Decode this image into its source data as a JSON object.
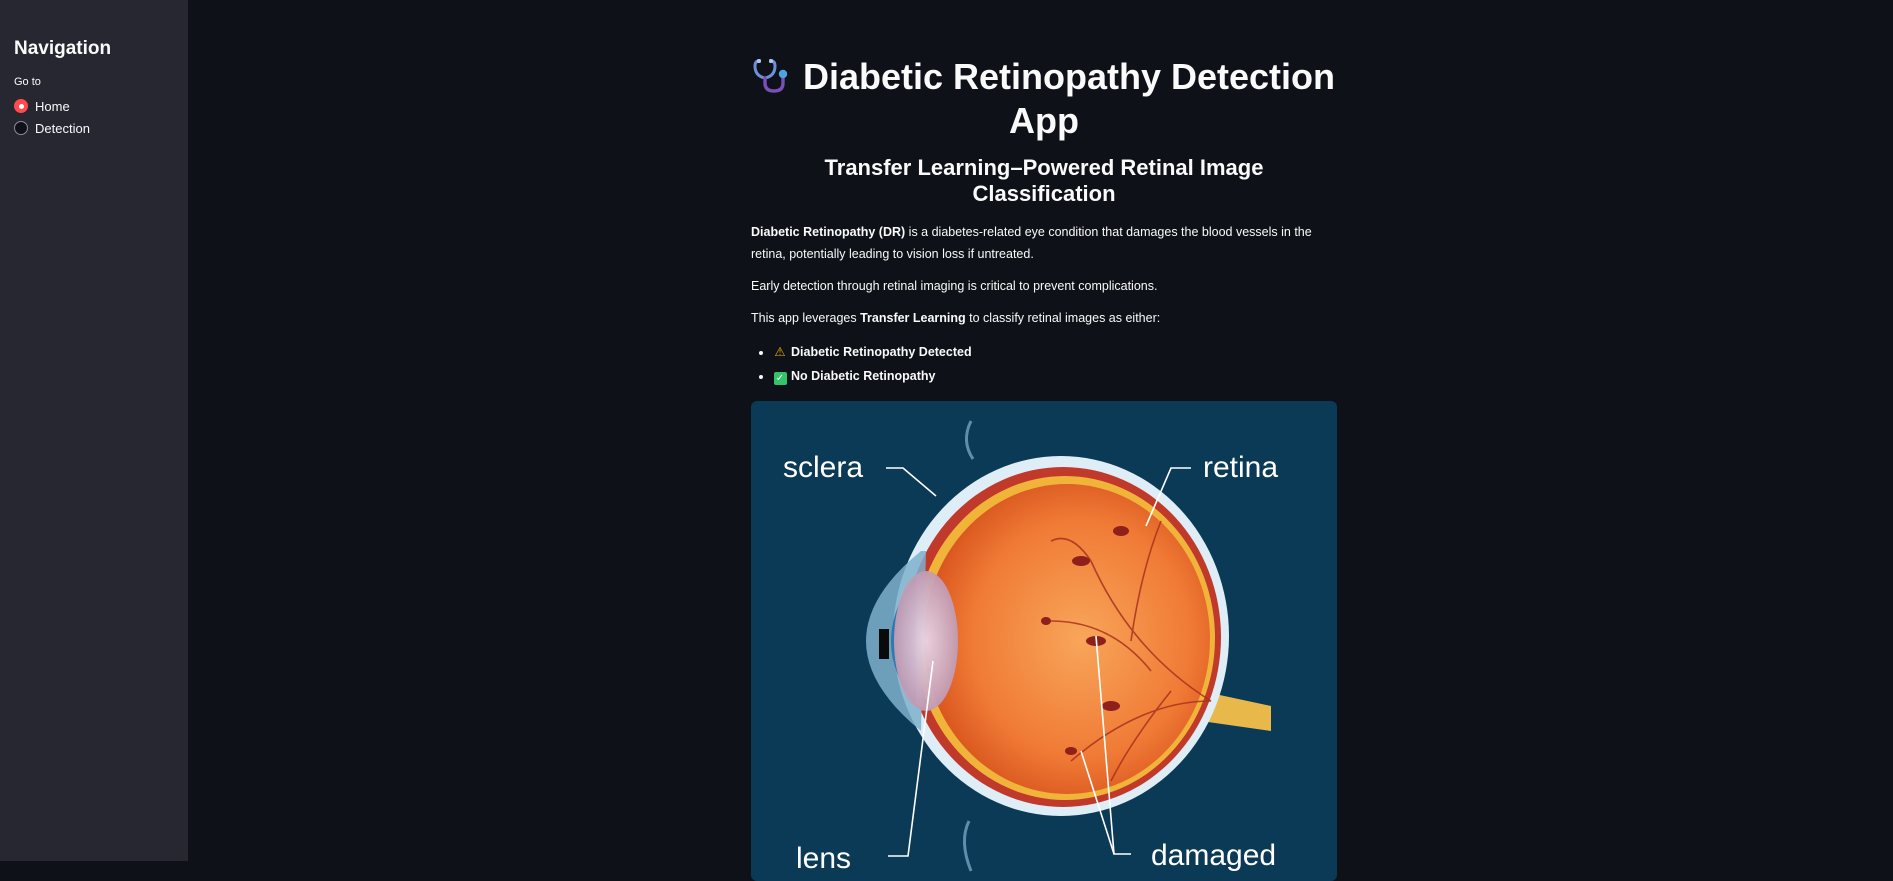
{
  "sidebar": {
    "title": "Navigation",
    "radio_label": "Go to",
    "options": [
      {
        "label": "Home",
        "selected": true
      },
      {
        "label": "Detection",
        "selected": false
      }
    ]
  },
  "main": {
    "title_icon": "stethoscope-icon",
    "title": "Diabetic Retinopathy Detection App",
    "subtitle": "Transfer Learning–Powered Retinal Image Classification",
    "p1_bold": "Diabetic Retinopathy (DR)",
    "p1_rest": " is a diabetes-related eye condition that damages the blood vessels in the retina, potentially leading to vision loss if untreated.",
    "p2": "Early detection through retinal imaging is critical to prevent complications.",
    "p3_start": "This app leverages ",
    "p3_bold": "Transfer Learning",
    "p3_end": " to classify retinal images as either:",
    "classes": [
      {
        "icon": "warning-icon",
        "label": "Diabetic Retinopathy Detected"
      },
      {
        "icon": "check-mark-icon",
        "label": "No Diabetic Retinopathy"
      }
    ],
    "image": {
      "labels": {
        "sclera": "sclera",
        "retina": "retina",
        "lens": "lens",
        "damaged": "damaged"
      }
    }
  },
  "colors": {
    "background": "#0e1117",
    "sidebar": "#262730",
    "accent": "#ff4b4b",
    "image_bg": "#0a3a55"
  }
}
